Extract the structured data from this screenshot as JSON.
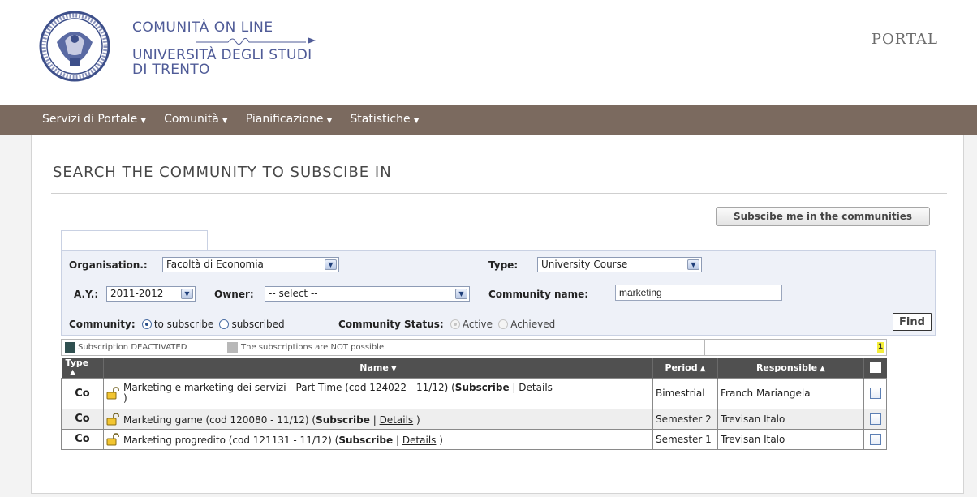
{
  "header": {
    "brand_line1": "COMUNITÀ ON LINE",
    "brand_line2": "UNIVERSITÀ DEGLI STUDI",
    "brand_line3": "DI TRENTO",
    "portal_label": "PORTAL",
    "seal_icon": "university-seal-icon"
  },
  "nav": {
    "items": [
      {
        "label": "Servizi di Portale"
      },
      {
        "label": "Comunità"
      },
      {
        "label": "Pianificazione"
      },
      {
        "label": "Statistiche"
      }
    ],
    "caret": "▼"
  },
  "page": {
    "title": "SEARCH THE COMMUNITY TO SUBSCIBE IN",
    "subscribe_button": "Subscibe me in the communities"
  },
  "filters": {
    "organisation_label": "Organisation.:",
    "organisation_value": "Facoltà di Economia",
    "type_label": "Type:",
    "type_value": "University Course",
    "ay_label": "A.Y.:",
    "ay_value": "2011-2012",
    "owner_label": "Owner:",
    "owner_value": "-- select --",
    "community_name_label": "Community name:",
    "community_name_value": "marketing",
    "community_label": "Community:",
    "community_options": [
      "to subscribe",
      "subscribed"
    ],
    "community_selected": "to subscribe",
    "status_label": "Community Status:",
    "status_options": [
      "Active",
      "Achieved"
    ],
    "find_button": "Find"
  },
  "legend": {
    "deactivated_text": "Subscription DEACTIVATED",
    "deactivated_color": "#2f4f4f",
    "not_possible_text": "The subscriptions are NOT possible",
    "not_possible_color": "#b8b8b8",
    "page_number": "1"
  },
  "table": {
    "headers": {
      "type": "Type",
      "name": "Name",
      "period": "Period",
      "responsible": "Responsible"
    },
    "rows": [
      {
        "type": "Co",
        "name": "Marketing e marketing dei servizi - Part Time (cod 124022 - 11/12) (",
        "subscribe": "Subscribe",
        "separator": "|",
        "details": "Details",
        "close": ")",
        "period": "Bimestrial",
        "responsible": "Franch Mariangela"
      },
      {
        "type": "Co",
        "name": "Marketing game (cod 120080 - 11/12) (",
        "subscribe": "Subscribe",
        "separator": "|",
        "details": "Details",
        "close": ")",
        "period": "Semester 2",
        "responsible": "Trevisan Italo"
      },
      {
        "type": "Co",
        "name": "Marketing progredito (cod 121131 - 11/12) (",
        "subscribe": "Subscribe",
        "separator": "|",
        "details": "Details",
        "close": ")",
        "period": "Semester 1",
        "responsible": "Trevisan Italo"
      }
    ]
  }
}
